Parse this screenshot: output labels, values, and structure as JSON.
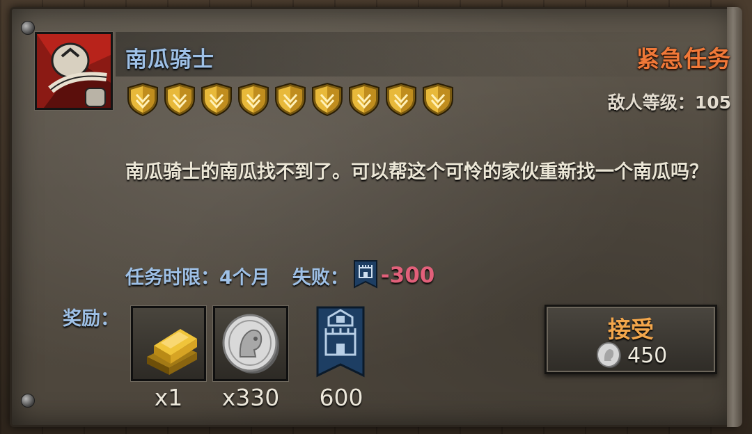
{
  "quest": {
    "title": "南瓜骑士",
    "urgency_label": "紧急任务",
    "enemy_level_label": "敌人等级：",
    "enemy_level": "105",
    "difficulty_shields": 9,
    "description": "南瓜骑士的南瓜找不到了。可以帮这个可怜的家伙重新找一个南瓜吗？",
    "time_limit_label": "任务时限：",
    "time_limit_value": "4个月",
    "failure_label": "失败：",
    "failure_penalty": "-300",
    "failure_icon": "fortress-banner-icon"
  },
  "rewards": {
    "label": "奖励：",
    "items": [
      {
        "icon": "gold-bar-icon",
        "qty": "x1"
      },
      {
        "icon": "silver-coin-icon",
        "qty": "x330"
      },
      {
        "icon": "fortress-banner-icon",
        "qty": "600"
      }
    ]
  },
  "accept_button": {
    "label": "接受",
    "cost": "450",
    "cost_icon": "silver-coin-icon"
  },
  "colors": {
    "title": "#9ec0e6",
    "urgent": "#f07838",
    "penalty": "#e2607a",
    "accept_label": "#f3a64b"
  }
}
